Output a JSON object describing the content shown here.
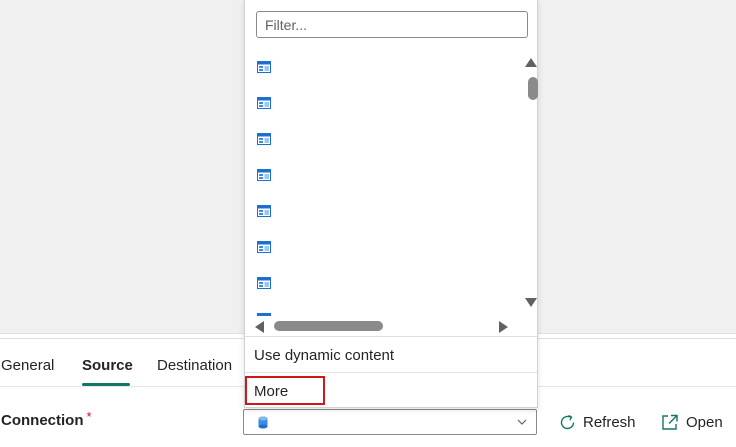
{
  "tabs": [
    {
      "label": "General",
      "active": false
    },
    {
      "label": "Source",
      "active": true
    },
    {
      "label": "Destination",
      "active": false
    }
  ],
  "connection": {
    "label": "Connection",
    "required_mark": "*",
    "selected_icon": "database-icon"
  },
  "actions": {
    "refresh_label": "Refresh",
    "open_label": "Open"
  },
  "dropdown": {
    "filter_placeholder": "Filter...",
    "item_icon": "table-icon",
    "options": {
      "dynamic": "Use dynamic content",
      "more": "More"
    }
  },
  "colors": {
    "accent": "#117865",
    "required": "#c50f1f",
    "highlight": "#d0181b"
  }
}
